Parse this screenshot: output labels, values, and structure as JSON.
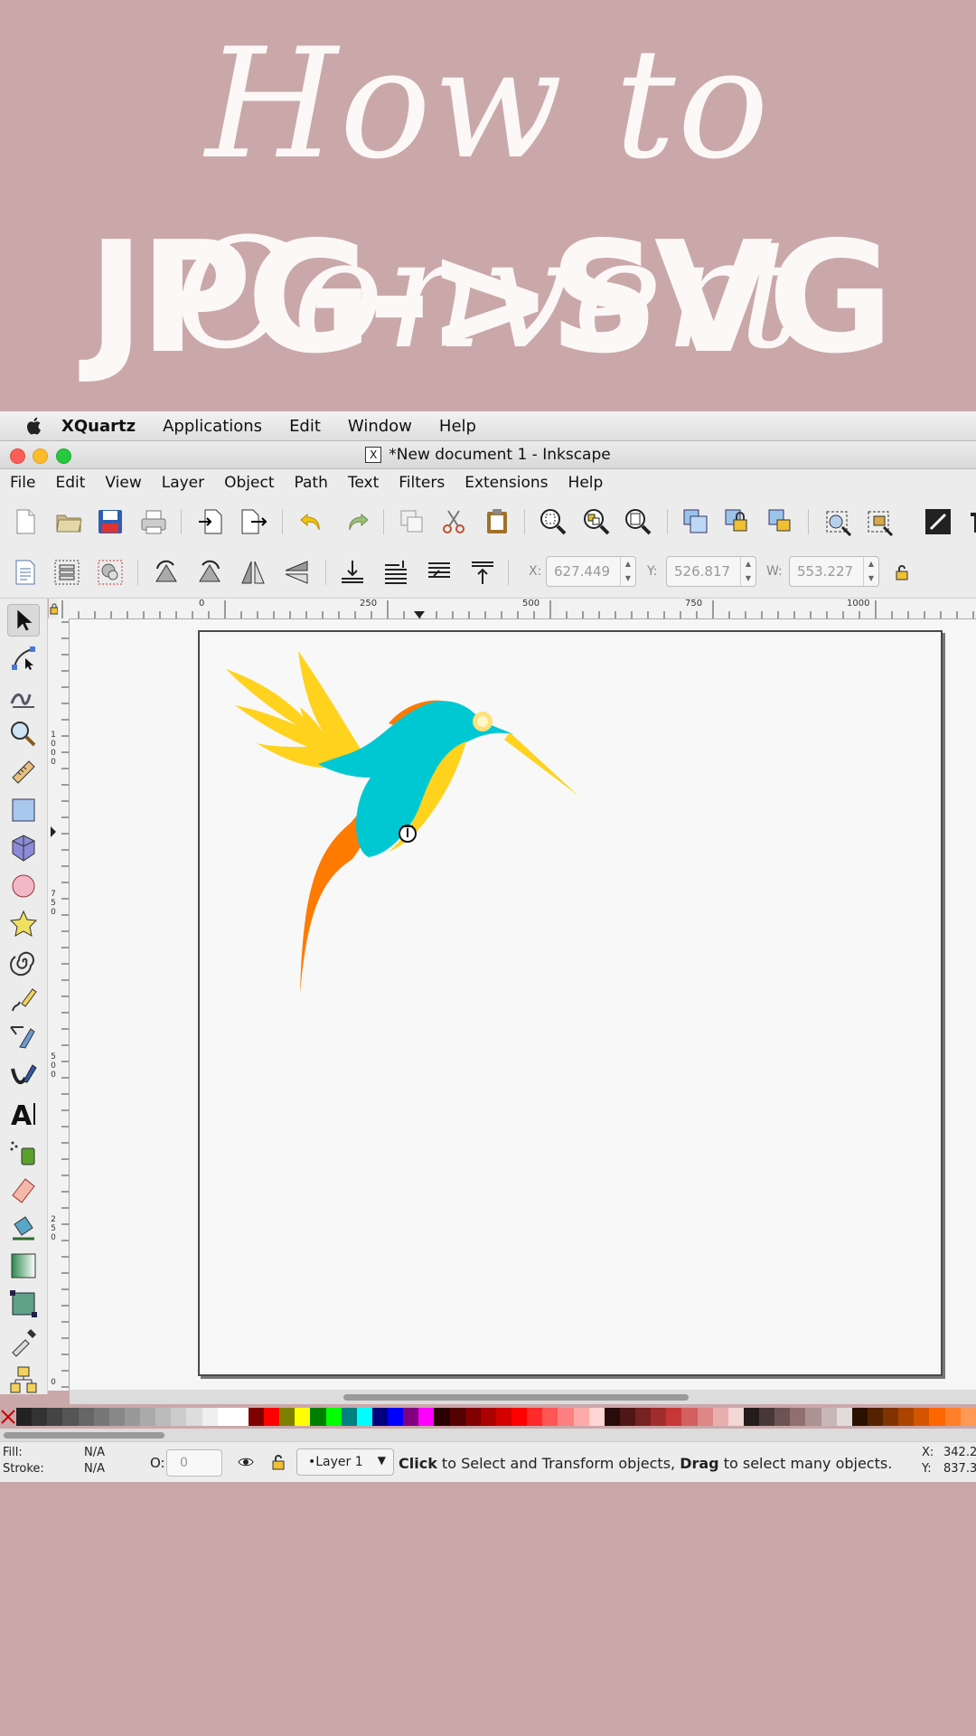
{
  "hero": {
    "script_line": "How to Convert",
    "bold_line": "JPG->SVG"
  },
  "mac_menubar": {
    "items": [
      "XQuartz",
      "Applications",
      "Edit",
      "Window",
      "Help"
    ]
  },
  "window": {
    "title": "*New document 1 - Inkscape",
    "x_icon": "X"
  },
  "app_menu": [
    "File",
    "Edit",
    "View",
    "Layer",
    "Object",
    "Path",
    "Text",
    "Filters",
    "Extensions",
    "Help"
  ],
  "controls": {
    "x_label": "X:",
    "x_value": "627.449",
    "y_label": "Y:",
    "y_value": "526.817",
    "w_label": "W:",
    "w_value": "553.227"
  },
  "ruler_top": [
    "0",
    "250",
    "500",
    "750",
    "1000"
  ],
  "ruler_left": [
    "1000",
    "750",
    "500",
    "250",
    "0"
  ],
  "colors": {
    "accent_teal": "#00c8d2",
    "accent_orange": "#ff7a00",
    "accent_yellow": "#ffd21e",
    "hero_bg": "#caa8aa"
  },
  "status": {
    "fill_label": "Fill:",
    "fill_value": "N/A",
    "stroke_label": "Stroke:",
    "stroke_value": "N/A",
    "opacity_label": "O:",
    "opacity_value": "0",
    "layer": "•Layer 1",
    "msg_click": "Click",
    "msg_1": " to Select and Transform objects, ",
    "msg_drag": "Drag",
    "msg_2": " to select many objects.",
    "x_label": "X:",
    "x_value": "342.2",
    "y_label": "Y:",
    "y_value": "837.3"
  }
}
